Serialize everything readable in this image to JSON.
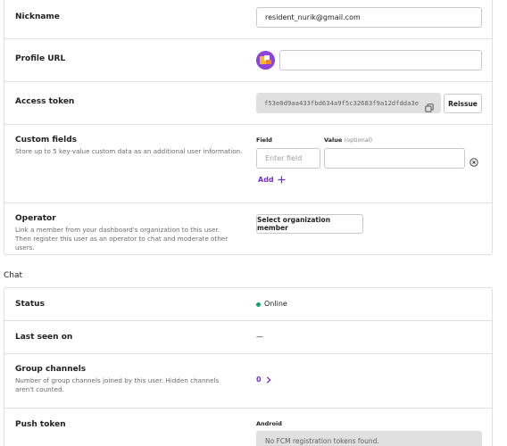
{
  "profile": {
    "nickname": {
      "label": "Nickname",
      "value": "resident_nurik@gmail.com"
    },
    "profile_url": {
      "label": "Profile URL",
      "value": ""
    },
    "access_token": {
      "label": "Access token",
      "value": "f53e0d9aa433fbd634a9f5c32683f9a12dfdda3e",
      "reissue_label": "Reissue"
    },
    "custom_fields": {
      "label": "Custom fields",
      "description": "Store up to 5 key-value custom data as an additional user information.",
      "field_header": "Field",
      "value_header": "Value",
      "value_optional": "(optional)",
      "field_placeholder": "Enter field",
      "value_placeholder": "",
      "add_label": "Add"
    },
    "operator": {
      "label": "Operator",
      "description": "Link a member from your dashboard's organization to this user. Then register this user as an operator to chat and moderate other users.",
      "button_label": "Select organization member"
    }
  },
  "chat": {
    "section_title": "Chat",
    "status": {
      "label": "Status",
      "value": "Online",
      "color": "#00a76f"
    },
    "last_seen": {
      "label": "Last seen on",
      "value": "—"
    },
    "group_channels": {
      "label": "Group channels",
      "description": "Number of group channels joined by this user. Hidden channels aren't counted.",
      "value": "0",
      "accent": "#742ddd"
    },
    "push_token": {
      "label": "Push token",
      "platform": "Android",
      "empty_text": "No FCM registration tokens found."
    }
  },
  "colors": {
    "accent": "#742ddd",
    "border": "#e0e0e0",
    "readonly_bg": "#e0e0e0"
  }
}
